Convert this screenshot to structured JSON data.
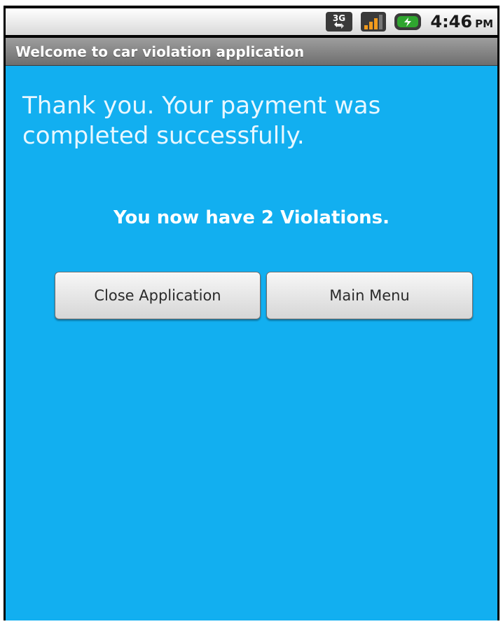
{
  "status_bar": {
    "network_label": "3G",
    "time": "4:46",
    "ampm": "PM"
  },
  "title_bar": {
    "title": "Welcome to car violation application"
  },
  "main": {
    "message": "Thank you. Your payment was completed successfully.",
    "violations_text": "You now have 2 Violations.",
    "buttons": {
      "close_label": "Close Application",
      "menu_label": "Main Menu"
    }
  },
  "icons": [
    "network-3g-icon",
    "signal-icon",
    "battery-icon"
  ],
  "colors": {
    "background": "#12aff0",
    "title_bar": "#858585",
    "status_bar": "#e6e6e6",
    "battery_fill": "#2fa52f"
  }
}
